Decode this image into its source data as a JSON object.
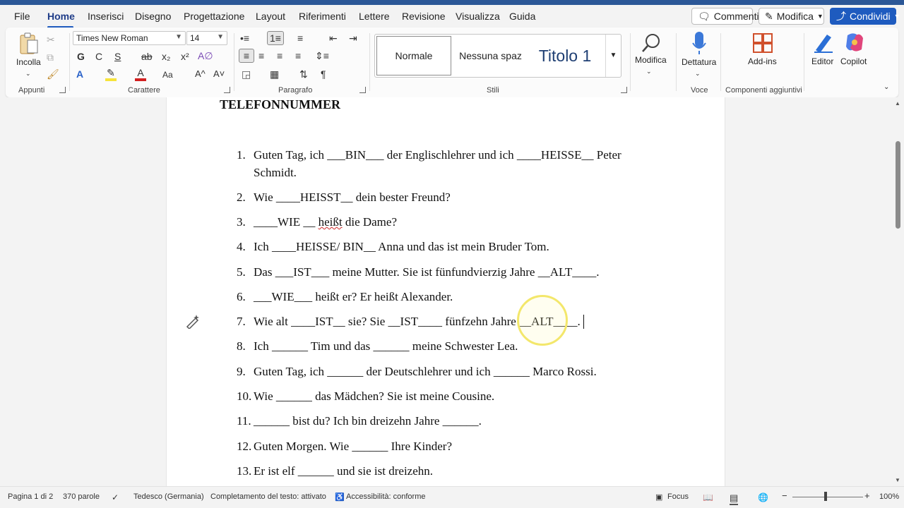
{
  "menu": {
    "tabs": [
      "File",
      "Home",
      "Inserisci",
      "Disegno",
      "Progettazione",
      "Layout",
      "Riferimenti",
      "Lettere",
      "Revisione",
      "Visualizza",
      "Guida"
    ],
    "active": "Home",
    "comments_label": "Commenti",
    "edit_label": "Modifica",
    "share_label": "Condividi"
  },
  "ribbon": {
    "clipboard": {
      "paste_label": "Incolla",
      "group_label": "Appunti"
    },
    "font": {
      "name": "Times New Roman",
      "size": "14",
      "group_label": "Carattere",
      "bold": "G",
      "italic": "C",
      "underline": "S",
      "strike": "ab",
      "subscript": "x₂",
      "superscript": "x²",
      "change_case": "Aa",
      "grow": "A^",
      "shrink": "A˅"
    },
    "paragraph": {
      "group_label": "Paragrafo"
    },
    "styles": {
      "items": [
        "Normale",
        "Nessuna spaz",
        "Titolo 1"
      ],
      "group_label": "Stili"
    },
    "editing": {
      "label": "Modifica"
    },
    "voice": {
      "dictate_label": "Dettatura",
      "group_label": "Voce"
    },
    "addins": {
      "label": "Add-ins",
      "group_label": "Componenti aggiuntivi"
    },
    "editor_label": "Editor",
    "copilot_label": "Copilot"
  },
  "document": {
    "heading": "TELEFONNUMMER",
    "items": [
      {
        "num": "1.",
        "text": "Guten Tag, ich ___BIN___ der Englischlehrer und ich ____HEISSE__ Peter Schmidt."
      },
      {
        "num": "2.",
        "text": "Wie ____HEISST__ dein bester Freund?"
      },
      {
        "num": "3.",
        "pre": "____WIE __ ",
        "squiggle": "heißt",
        "post": " die Dame?"
      },
      {
        "num": "4.",
        "text": "Ich ____HEISSE/ BIN__ Anna und das ist mein Bruder Tom."
      },
      {
        "num": "5.",
        "text": "Das ___IST___ meine Mutter. Sie ist fünfundvierzig Jahre __ALT____."
      },
      {
        "num": "6.",
        "text": "___WIE___ heißt er? Er heißt Alexander."
      },
      {
        "num": "7.",
        "text": "Wie alt ____IST__ sie? Sie __IST____ fünfzehn Jahre __ALT____."
      },
      {
        "num": "8.",
        "text": "Ich ______ Tim und das ______ meine Schwester Lea."
      },
      {
        "num": "9.",
        "text": "Guten Tag, ich ______ der Deutschlehrer und ich ______ Marco Rossi."
      },
      {
        "num": "10.",
        "text": "Wie ______ das Mädchen? Sie ist meine Cousine."
      },
      {
        "num": "11.",
        "text": "______ bist du? Ich bin dreizehn Jahre ______."
      },
      {
        "num": "12.",
        "text": "Guten Morgen. Wie ______ Ihre Kinder?"
      },
      {
        "num": "13.",
        "text": "Er ist elf ______ und sie ist dreizehn."
      }
    ]
  },
  "status": {
    "page": "Pagina 1 di 2",
    "words": "370 parole",
    "language": "Tedesco (Germania)",
    "autocomplete": "Completamento del testo: attivato",
    "accessibility": "Accessibilità: conforme",
    "focus": "Focus",
    "zoom": "100%"
  }
}
